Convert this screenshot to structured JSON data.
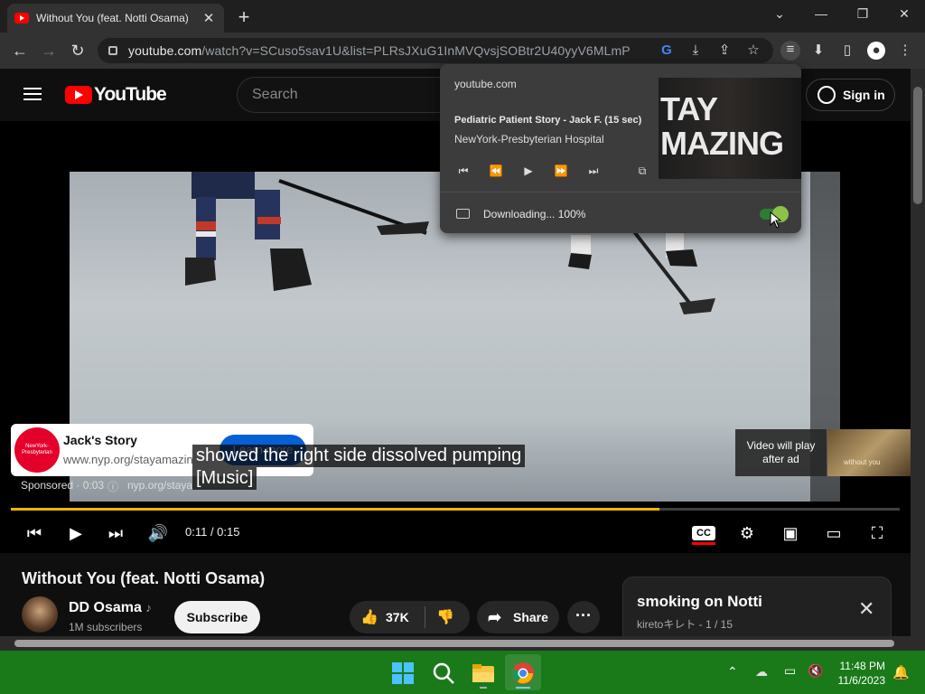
{
  "browser": {
    "tab_title": "Without You (feat. Notti Osama)",
    "tab_close": "✕",
    "new_tab": "+",
    "url_host": "youtube.com",
    "url_path": "/watch?v=SCuso5sav1U&list=PLRsJXuG1InMVQvsjSOBtr2U40yyV6MLmP"
  },
  "youtube": {
    "logo_text": "YouTube",
    "search_placeholder": "Search",
    "signin_label": "Sign in"
  },
  "media_popup": {
    "host": "youtube.com",
    "title": "Pediatric Patient Story - Jack F.  (15 sec)",
    "artist": "NewYork-Presbyterian Hospital",
    "artwork_text": "TAY\nMAZING",
    "download_status": "Downloading... 100%",
    "toggle_on": true
  },
  "ad": {
    "title": "Jack's Story",
    "url": "www.nyp.org/stayamazin",
    "logo_text": "NewYork-Presbyterian",
    "cta": "Learn more",
    "sponsored": "Sponsored · 0:03",
    "sponsored_url": "nyp.org/staya",
    "video_will_play": "Video will play after ad"
  },
  "caption": {
    "line1": "showed the right side dissolved pumping",
    "line2": "[Music]"
  },
  "player": {
    "time": "0:11 / 0:15",
    "progress": 0.73
  },
  "video": {
    "title": "Without You (feat. Notti Osama)",
    "channel": "DD Osama",
    "channel_note": "♪",
    "subscribers": "1M subscribers",
    "subscribe_label": "Subscribe",
    "likes": "37K",
    "share_label": "Share"
  },
  "playlist": {
    "title": "smoking on Notti",
    "subtitle": "kiretoキレト - 1 / 15"
  },
  "taskbar": {
    "time": "11:48 PM",
    "date": "11/6/2023"
  }
}
